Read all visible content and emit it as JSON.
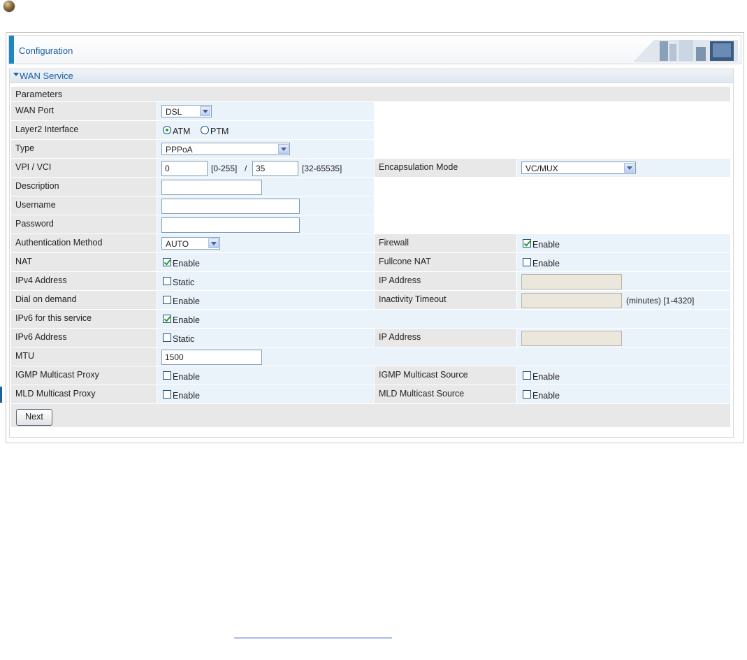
{
  "header": {
    "config_title": "Configuration"
  },
  "section": {
    "title": "WAN Service",
    "params_label": "Parameters"
  },
  "fields": {
    "wan_port": {
      "label": "WAN Port",
      "value": "DSL"
    },
    "layer2": {
      "label": "Layer2 Interface",
      "opt1": "ATM",
      "opt2": "PTM",
      "selected": "ATM"
    },
    "type": {
      "label": "Type",
      "value": "PPPoA"
    },
    "vpi_vci": {
      "label": "VPI / VCI",
      "vpi": "0",
      "vpi_range": "[0-255]",
      "sep": "/",
      "vci": "35",
      "vci_range": "[32-65535]"
    },
    "encap": {
      "label": "Encapsulation Mode",
      "value": "VC/MUX"
    },
    "description": {
      "label": "Description",
      "value": ""
    },
    "username": {
      "label": "Username",
      "value": ""
    },
    "password": {
      "label": "Password",
      "value": ""
    },
    "auth": {
      "label": "Authentication Method",
      "value": "AUTO"
    },
    "firewall": {
      "label": "Firewall",
      "cb_label": "Enable",
      "checked": true
    },
    "nat": {
      "label": "NAT",
      "cb_label": "Enable",
      "checked": true
    },
    "fullcone": {
      "label": "Fullcone NAT",
      "cb_label": "Enable",
      "checked": false
    },
    "ipv4": {
      "label": "IPv4 Address",
      "cb_label": "Static",
      "checked": false
    },
    "ip_addr": {
      "label": "IP Address",
      "value": ""
    },
    "dial": {
      "label": "Dial on demand",
      "cb_label": "Enable",
      "checked": false
    },
    "inactivity": {
      "label": "Inactivity Timeout",
      "value": "",
      "suffix": "(minutes)  [1-4320]"
    },
    "ipv6_service": {
      "label": "IPv6 for this service",
      "cb_label": "Enable",
      "checked": true
    },
    "ipv6": {
      "label": "IPv6 Address",
      "cb_label": "Static",
      "checked": false
    },
    "ip6_addr": {
      "label": "IP Address",
      "value": ""
    },
    "mtu": {
      "label": "MTU",
      "value": "1500"
    },
    "igmp_proxy": {
      "label": "IGMP Multicast Proxy",
      "cb_label": "Enable",
      "checked": false
    },
    "igmp_source": {
      "label": "IGMP Multicast Source",
      "cb_label": "Enable",
      "checked": false
    },
    "mld_proxy": {
      "label": "MLD Multicast Proxy",
      "cb_label": "Enable",
      "checked": false
    },
    "mld_source": {
      "label": "MLD Multicast Source",
      "cb_label": "Enable",
      "checked": false
    }
  },
  "buttons": {
    "next": "Next"
  }
}
